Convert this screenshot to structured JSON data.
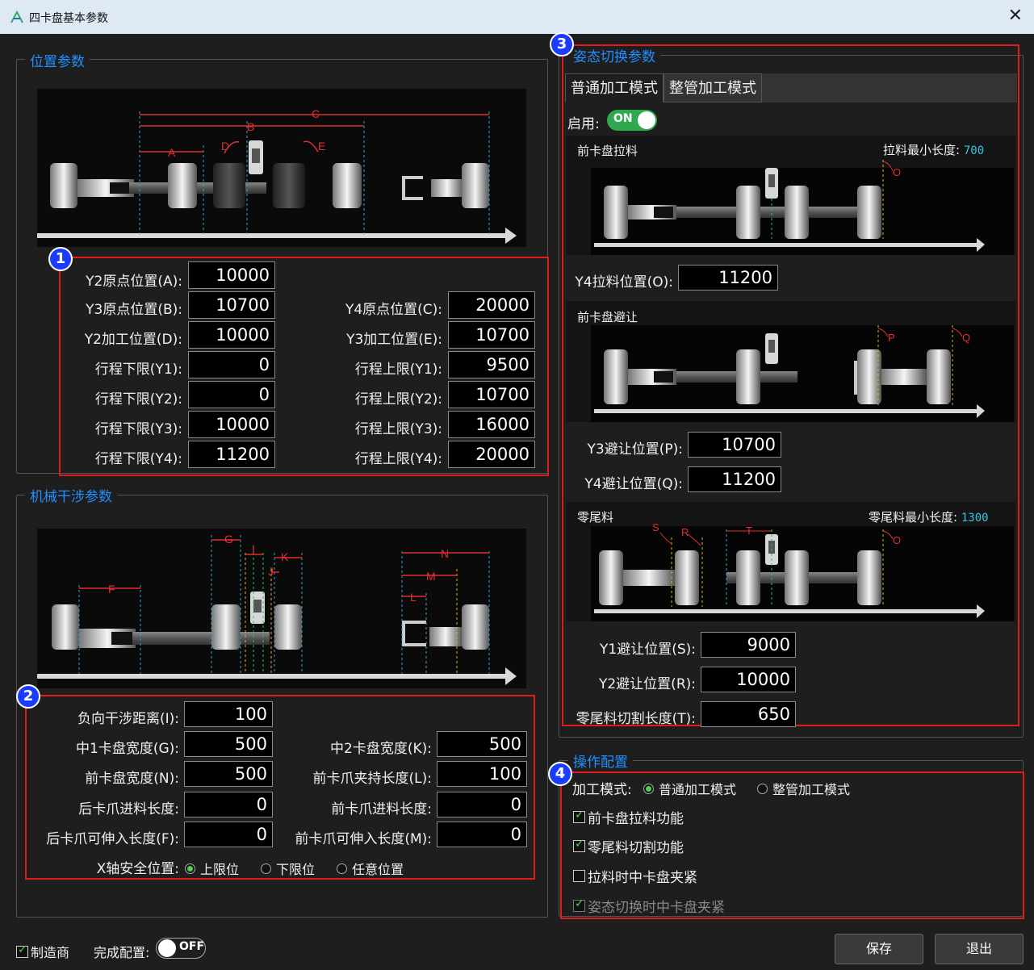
{
  "window": {
    "title": "四卡盘基本参数",
    "close_glyph": "✕"
  },
  "position": {
    "title": "位置参数",
    "badge": "1",
    "diagram_labels": {
      "A": "A",
      "B": "B",
      "C": "C",
      "D": "D",
      "E": "E"
    },
    "fields": [
      {
        "label": "Y2原点位置(A):",
        "value": "10000"
      },
      {
        "label": "Y3原点位置(B):",
        "value": "10700"
      },
      {
        "label": "Y4原点位置(C):",
        "value": "20000"
      },
      {
        "label": "Y2加工位置(D):",
        "value": "10000"
      },
      {
        "label": "Y3加工位置(E):",
        "value": "10700"
      },
      {
        "label": "行程下限(Y1):",
        "value": "0"
      },
      {
        "label": "行程上限(Y1):",
        "value": "9500"
      },
      {
        "label": "行程下限(Y2):",
        "value": "0"
      },
      {
        "label": "行程上限(Y2):",
        "value": "10700"
      },
      {
        "label": "行程下限(Y3):",
        "value": "10000"
      },
      {
        "label": "行程上限(Y3):",
        "value": "16000"
      },
      {
        "label": "行程下限(Y4):",
        "value": "11200"
      },
      {
        "label": "行程上限(Y4):",
        "value": "20000"
      }
    ]
  },
  "interference": {
    "title": "机械干涉参数",
    "badge": "2",
    "diagram_labels": {
      "F": "F",
      "G": "G",
      "I": "I",
      "J": "J",
      "K": "K",
      "L": "L",
      "M": "M",
      "N": "N"
    },
    "fields": [
      {
        "label": "负向干涉距离(I):",
        "value": "100"
      },
      {
        "label": "中1卡盘宽度(G):",
        "value": "500"
      },
      {
        "label": "中2卡盘宽度(K):",
        "value": "500"
      },
      {
        "label": "前卡盘宽度(N):",
        "value": "500"
      },
      {
        "label": "前卡爪夹持长度(L):",
        "value": "100"
      },
      {
        "label": "后卡爪进料长度:",
        "value": "0"
      },
      {
        "label": "前卡爪进料长度:",
        "value": "0"
      },
      {
        "label": "后卡爪可伸入长度(F):",
        "value": "0"
      },
      {
        "label": "前卡爪可伸入长度(M):",
        "value": "0"
      }
    ],
    "x_safe": {
      "label": "X轴安全位置:",
      "options": [
        "上限位",
        "下限位",
        "任意位置"
      ],
      "selected": "上限位"
    }
  },
  "posture": {
    "title": "姿态切换参数",
    "badge": "3",
    "tabs": [
      "普通加工模式",
      "整管加工模式"
    ],
    "active_tab": "普通加工模式",
    "enable_label": "启用:",
    "enable_state": "ON",
    "pull": {
      "caption": "前卡盘拉料",
      "min_label": "拉料最小长度:",
      "min_value": "700",
      "marker": "O",
      "field_label": "Y4拉料位置(O):",
      "field_value": "11200"
    },
    "avoid": {
      "caption": "前卡盘避让",
      "markers": [
        "P",
        "Q"
      ],
      "fields": [
        {
          "label": "Y3避让位置(P):",
          "value": "10700"
        },
        {
          "label": "Y4避让位置(Q):",
          "value": "11200"
        }
      ]
    },
    "tail": {
      "caption": "零尾料",
      "min_label": "零尾料最小长度:",
      "min_value": "1300",
      "markers": [
        "S",
        "R",
        "T",
        "O"
      ],
      "fields": [
        {
          "label": "Y1避让位置(S):",
          "value": "9000"
        },
        {
          "label": "Y2避让位置(R):",
          "value": "10000"
        },
        {
          "label": "零尾料切割长度(T):",
          "value": "650"
        }
      ]
    }
  },
  "operation": {
    "title": "操作配置",
    "badge": "4",
    "mode_label": "加工模式:",
    "modes": [
      "普通加工模式",
      "整管加工模式"
    ],
    "selected_mode": "普通加工模式",
    "checks": [
      {
        "label": "前卡盘拉料功能",
        "checked": true,
        "enabled": true
      },
      {
        "label": "零尾料切割功能",
        "checked": true,
        "enabled": true
      },
      {
        "label": "拉料时中卡盘夹紧",
        "checked": false,
        "enabled": true
      },
      {
        "label": "姿态切换时中卡盘夹紧",
        "checked": true,
        "enabled": false
      }
    ]
  },
  "footer": {
    "manufacturer_label": "制造商",
    "manufacturer_checked": true,
    "complete_label": "完成配置:",
    "complete_state": "OFF",
    "save_label": "保存",
    "exit_label": "退出"
  },
  "colors": {
    "accent": "#1e90ff",
    "highlight": "#e01b1b",
    "toggle_on": "#2fa84f",
    "cyan": "#33c5e8"
  }
}
